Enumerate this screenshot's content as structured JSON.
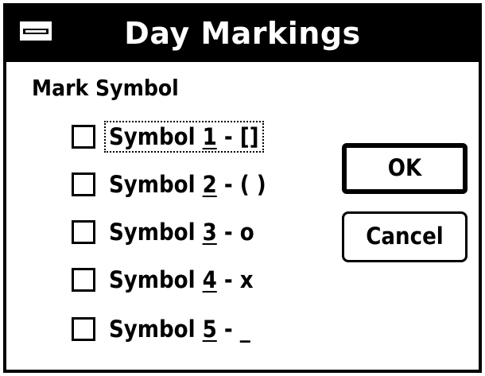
{
  "window": {
    "title": "Day Markings"
  },
  "group": {
    "label": "Mark Symbol"
  },
  "options": [
    {
      "prefix": "Symbol ",
      "mnemonic": "1",
      "suffix": " - []",
      "checked": false,
      "focused": true
    },
    {
      "prefix": "Symbol ",
      "mnemonic": "2",
      "suffix": " - ( )",
      "checked": false,
      "focused": false
    },
    {
      "prefix": "Symbol ",
      "mnemonic": "3",
      "suffix": " - o",
      "checked": false,
      "focused": false
    },
    {
      "prefix": "Symbol ",
      "mnemonic": "4",
      "suffix": " - x",
      "checked": false,
      "focused": false
    },
    {
      "prefix": "Symbol ",
      "mnemonic": "5",
      "suffix": " - _",
      "checked": false,
      "focused": false
    }
  ],
  "buttons": {
    "ok_label": "OK",
    "cancel_label": "Cancel"
  }
}
